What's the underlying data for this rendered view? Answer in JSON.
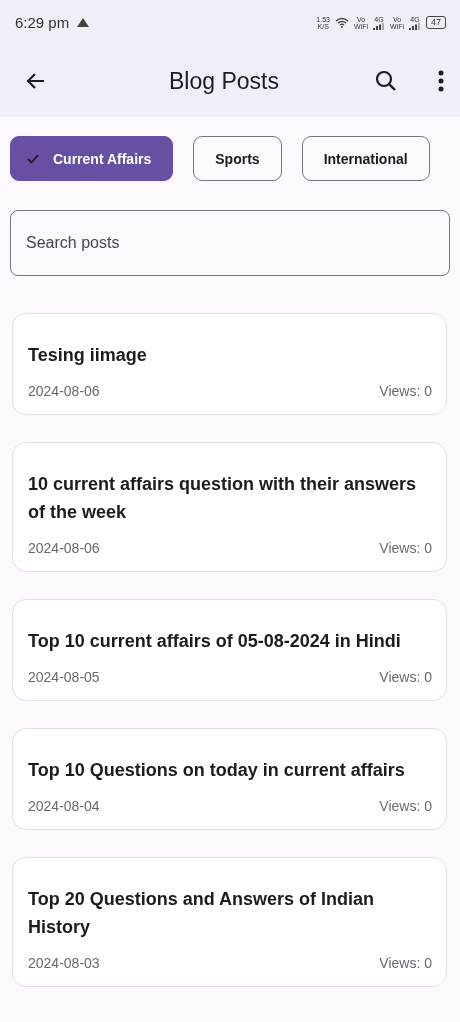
{
  "status_bar": {
    "time": "6:29 pm",
    "speed": "1.53",
    "speed_unit": "K/S",
    "sims": [
      {
        "vo": "Vo",
        "wifi": "WiFi",
        "network": "4G"
      },
      {
        "vo": "Vo",
        "wifi": "WiFi",
        "network": "4G"
      }
    ],
    "battery": "47"
  },
  "app_bar": {
    "title": "Blog Posts"
  },
  "chips": [
    {
      "label": "Current Affairs",
      "selected": true
    },
    {
      "label": "Sports",
      "selected": false
    },
    {
      "label": "International",
      "selected": false
    }
  ],
  "search": {
    "placeholder": "Search posts"
  },
  "posts": [
    {
      "title": "Tesing iimage",
      "date": "2024-08-06",
      "views": "Views: 0"
    },
    {
      "title": "10 current affairs question with their answers of the week",
      "date": "2024-08-06",
      "views": "Views: 0"
    },
    {
      "title": "Top 10 current affairs of 05-08-2024 in Hindi",
      "date": "2024-08-05",
      "views": "Views: 0"
    },
    {
      "title": "Top 10 Questions on today in current affairs",
      "date": "2024-08-04",
      "views": "Views: 0"
    },
    {
      "title": "Top 20 Questions and Answers of Indian History",
      "date": "2024-08-03",
      "views": "Views: 0"
    }
  ]
}
